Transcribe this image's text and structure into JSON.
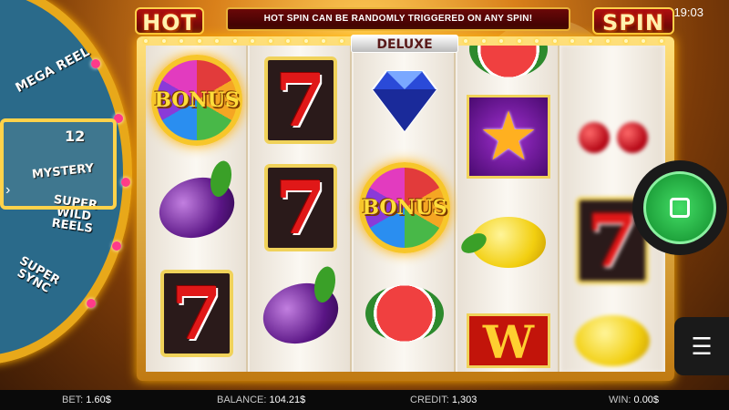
{
  "header": {
    "logo_left": "HOT",
    "logo_right": "SPIN",
    "banner": "HOT SPIN CAN BE RANDOMLY TRIGGERED ON ANY SPIN!",
    "subtitle": "DELUXE",
    "clock": "19:03"
  },
  "wheel": {
    "segments": [
      "MEGA REEL",
      "12",
      "MYSTERY",
      "SUPER WILD REELS",
      "SUPER SYNC"
    ]
  },
  "reels": [
    [
      "bonus",
      "plum",
      "seven"
    ],
    [
      "seven",
      "seven",
      "plum"
    ],
    [
      "diamond",
      "bonus",
      "watermelon"
    ],
    [
      "watermelon",
      "star",
      "lemon",
      "wild"
    ],
    [
      "cherry",
      "seven",
      "lemon"
    ]
  ],
  "symbols": {
    "seven": "7",
    "bonus": "BONUS",
    "wild": "W",
    "star": "★"
  },
  "controls": {
    "spin_icon": "stop-icon",
    "menu_icon": "menu-icon"
  },
  "footer": {
    "bet_label": "BET:",
    "bet_value": "1.60$",
    "balance_label": "BALANCE:",
    "balance_value": "104.21$",
    "credit_label": "CREDIT:",
    "credit_value": "1,303",
    "win_label": "WIN:",
    "win_value": "0.00$"
  }
}
